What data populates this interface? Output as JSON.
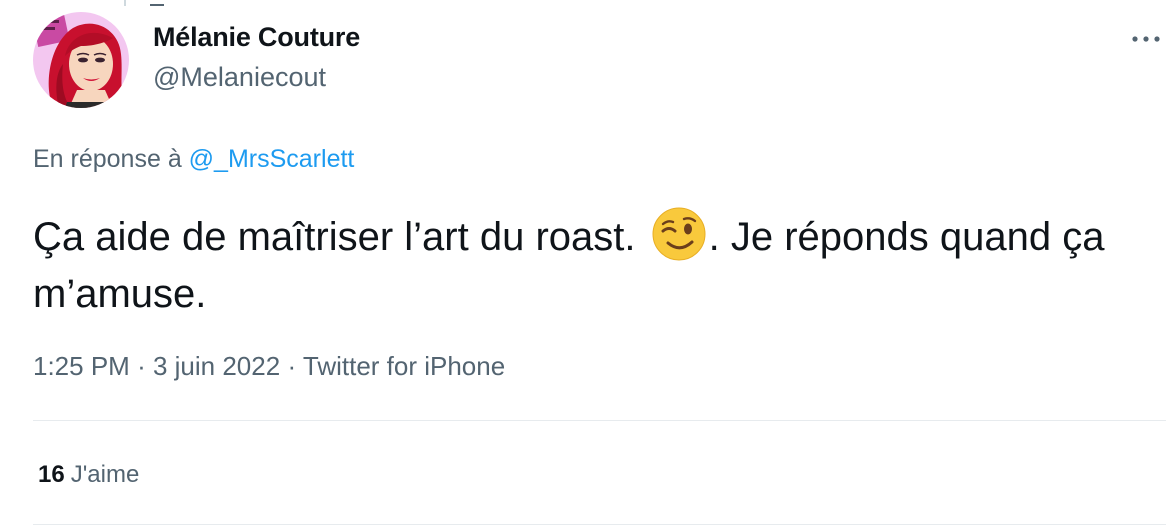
{
  "author": {
    "name": "Mélanie Couture",
    "handle": "@Melaniecout"
  },
  "menu": {
    "icon": "more-horizontal-icon",
    "label": "···"
  },
  "reply": {
    "prefix": "En réponse à",
    "mention": "@_MrsScarlett"
  },
  "tweet": {
    "text_part1": "Ça aide de maîtriser l’art du roast.",
    "emoji": "winking-face-emoji",
    "text_part2": ". Je réponds quand ça m’amuse."
  },
  "meta": {
    "time": "1:25 PM",
    "date": "3 juin 2022",
    "source": "Twitter for iPhone",
    "separator": "·"
  },
  "stats": {
    "likes_count": "16",
    "likes_label": "J'aime"
  },
  "colors": {
    "accent": "#1d9bf0",
    "text": "#0f1419",
    "secondary": "#536471",
    "avatar_bg": "#f3c7f0"
  }
}
